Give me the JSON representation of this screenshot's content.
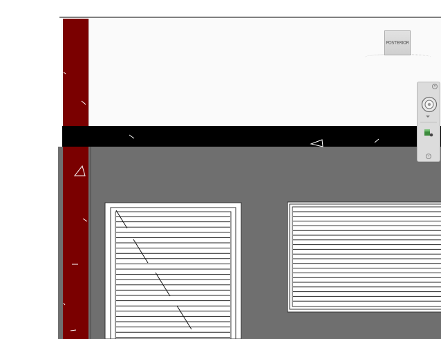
{
  "viewcube": {
    "face_label": "POSTERIOR"
  },
  "navigation_bar": {
    "close_icon": "close-icon",
    "wheel_icon": "steering-wheel-icon",
    "zoom_icon": "zoom-extents-icon",
    "options_icon": "chevron-down-icon"
  },
  "colors": {
    "wall": "#7a0000",
    "floor_band": "#000000",
    "wall_face": "#6f6f6f",
    "upper_area": "#fafafa",
    "window_frame": "#ffffff",
    "window_slat": "#222222"
  }
}
